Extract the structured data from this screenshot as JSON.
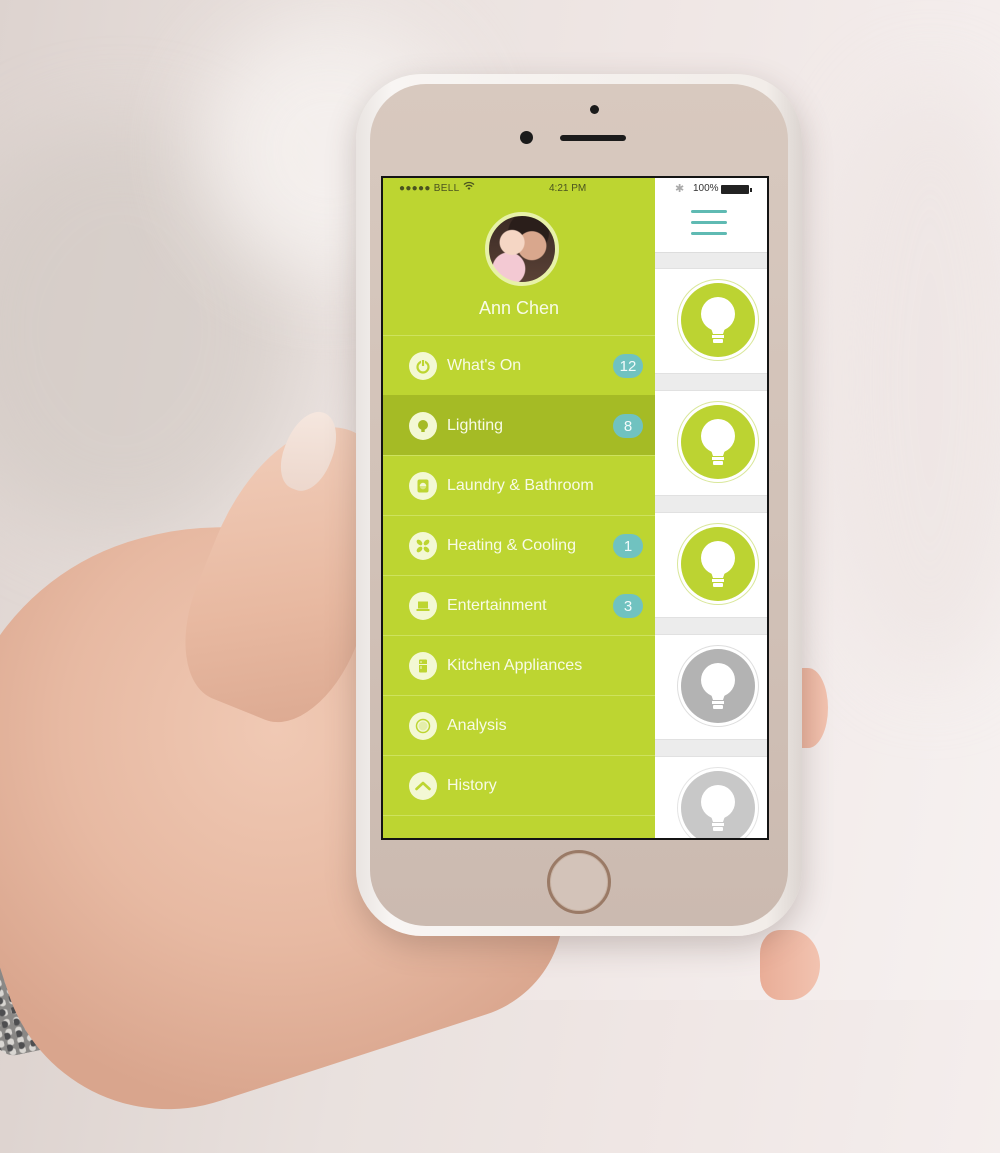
{
  "status_bar": {
    "carrier": "●●●●● BELL",
    "wifi_icon": "wifi-icon",
    "time": "4:21 PM",
    "bluetooth_icon": "bluetooth-icon",
    "battery": "100%"
  },
  "profile": {
    "name": "Ann Chen"
  },
  "menu": {
    "items": [
      {
        "label": "What's On",
        "icon": "power-icon",
        "badge": "12",
        "active": false
      },
      {
        "label": "Lighting",
        "icon": "lightbulb-icon",
        "badge": "8",
        "active": true
      },
      {
        "label": "Laundry & Bathroom",
        "icon": "washer-icon",
        "badge": null,
        "active": false
      },
      {
        "label": "Heating & Cooling",
        "icon": "fan-icon",
        "badge": "1",
        "active": false
      },
      {
        "label": "Entertainment",
        "icon": "laptop-icon",
        "badge": "3",
        "active": false
      },
      {
        "label": "Kitchen Appliances",
        "icon": "fridge-icon",
        "badge": null,
        "active": false
      },
      {
        "label": "Analysis",
        "icon": "analysis-icon",
        "badge": null,
        "active": false
      },
      {
        "label": "History",
        "icon": "history-icon",
        "badge": null,
        "active": false
      }
    ]
  },
  "devices": [
    {
      "type": "light",
      "state": "on"
    },
    {
      "type": "light",
      "state": "on"
    },
    {
      "type": "light",
      "state": "on"
    },
    {
      "type": "light",
      "state": "off"
    },
    {
      "type": "light",
      "state": "off"
    }
  ],
  "colors": {
    "sidebar_green": "#bdd531",
    "active_row": "#a5bb25",
    "badge_teal": "#70c2c0",
    "hamburger_teal": "#5fbab3",
    "bulb_on": "#bcd332",
    "bulb_off": "#b3b3b3"
  }
}
